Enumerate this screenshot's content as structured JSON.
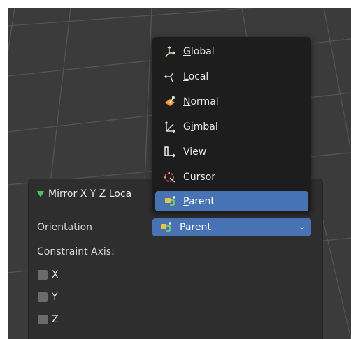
{
  "menu": {
    "items": [
      {
        "first": "G",
        "rest": "lobal",
        "icon": "global-orientation-icon"
      },
      {
        "first": "L",
        "rest": "ocal",
        "icon": "local-orientation-icon"
      },
      {
        "first": "N",
        "rest": "ormal",
        "icon": "normal-orientation-icon"
      },
      {
        "pre": "G",
        "first": "i",
        "rest": "mbal",
        "icon": "gimbal-orientation-icon"
      },
      {
        "first": "V",
        "rest": "iew",
        "icon": "view-orientation-icon"
      },
      {
        "first": "C",
        "rest": "ursor",
        "icon": "cursor-orientation-icon"
      },
      {
        "first": "P",
        "rest": "arent",
        "icon": "parent-orientation-icon",
        "selected": true
      }
    ]
  },
  "panel": {
    "title": "Mirror X Y Z Loca",
    "orientation_label": "Orientation",
    "orientation_value": "Parent",
    "constraint_label": "Constraint Axis:",
    "axes": [
      "X",
      "Y",
      "Z"
    ]
  },
  "colors": {
    "accent": "#4772b3",
    "menu_bg": "#1d1d1d",
    "panel_bg": "#2e2e2e",
    "viewport_bg": "#3b3b3b",
    "header_triangle": "#4cc35a"
  }
}
